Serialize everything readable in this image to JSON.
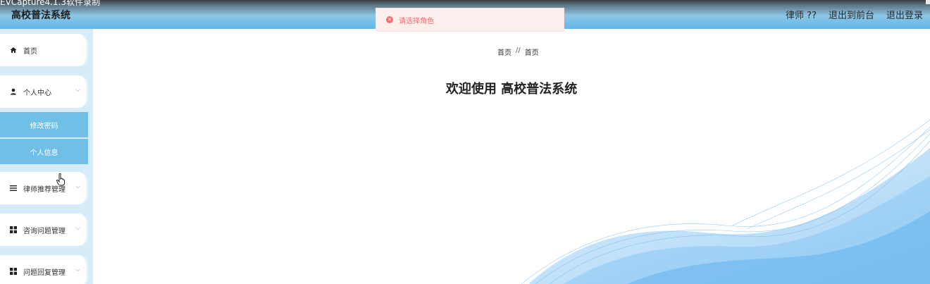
{
  "recorder_label": "EVCapture4.1.3软件录制",
  "header": {
    "title": "高校普法系统",
    "links": [
      "律师 ??",
      "退出到前台",
      "退出登录"
    ]
  },
  "toast": {
    "message": "请选择角色",
    "color": "#f56c6c"
  },
  "sidebar": {
    "items": [
      {
        "label": "首页",
        "icon": "home-icon"
      },
      {
        "label": "个人中心",
        "icon": "user-icon"
      },
      {
        "label": "律师推荐管理",
        "icon": "list-icon"
      },
      {
        "label": "咨询问题管理",
        "icon": "grid-icon"
      },
      {
        "label": "问题回复管理",
        "icon": "grid-icon"
      }
    ],
    "sub_items": [
      {
        "label": "修改密码"
      },
      {
        "label": "个人信息"
      }
    ]
  },
  "main": {
    "breadcrumb": [
      "首页",
      "//",
      "首页"
    ],
    "welcome": "欢迎使用 高校普法系统"
  },
  "colors": {
    "accent": "#6fbfe7",
    "sidebar_bg": "#d6ecf8",
    "header_blue": "#62b7ea"
  }
}
